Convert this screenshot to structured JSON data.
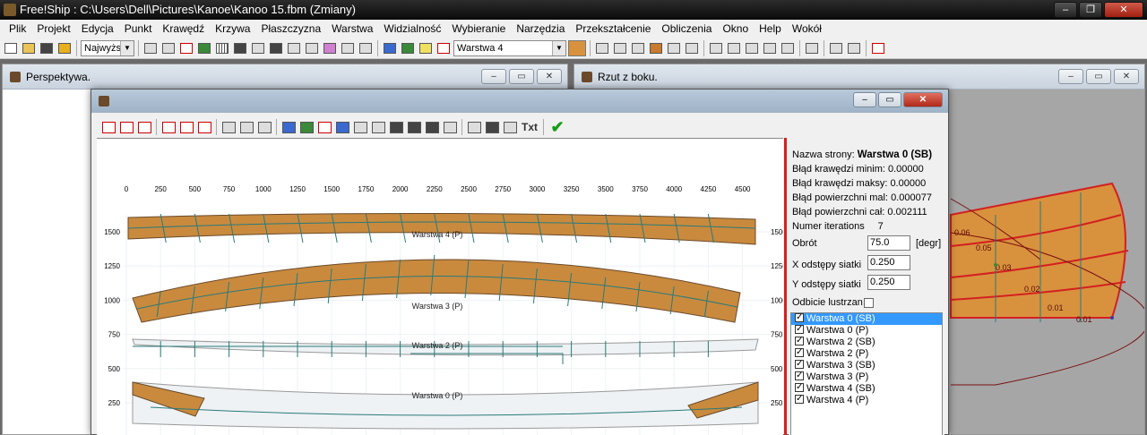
{
  "app": {
    "title": "Free!Ship  : C:\\Users\\Dell\\Pictures\\Kanoe\\Kanoo 15.fbm (Zmiany)"
  },
  "menu": [
    "Plik",
    "Projekt",
    "Edycja",
    "Punkt",
    "Krawędź",
    "Krzywa",
    "Płaszczyzna",
    "Warstwa",
    "Widzialność",
    "Wybieranie",
    "Narzędzia",
    "Przekształcenie",
    "Obliczenia",
    "Okno",
    "Help",
    "Wokół"
  ],
  "toolbar": {
    "precision_value": "Najwyższy",
    "layer_value": "Warstwa 4",
    "accent_color": "#d8923e"
  },
  "windows": {
    "perspective_title": "Perspektywa.",
    "side_title": "Rzut z boku."
  },
  "dialog": {
    "txt_label": "Txt",
    "props": {
      "page_name_label": "Nazwa strony:",
      "page_name_value": "Warstwa 0 (SB)",
      "edge_min_label": "Błąd krawędzi minim:",
      "edge_min_value": "0.00000",
      "edge_max_label": "Błąd krawędzi maksy:",
      "edge_max_value": "0.00000",
      "surf_min_label": "Błąd powierzchni mal:",
      "surf_min_value": "0.000077",
      "surf_total_label": "Błąd powierzchni cał:",
      "surf_total_value": "0.002111",
      "iterations_label": "Numer iterations",
      "iterations_value": "7",
      "rotation_label": "Obrót",
      "rotation_value": "75.0",
      "rotation_unit": "[degr]",
      "x_grid_label": "X odstępy siatki",
      "x_grid_value": "0.250",
      "y_grid_label": "Y odstępy siatki",
      "y_grid_value": "0.250",
      "mirror_label": "Odbicie lustrzan"
    },
    "layers": [
      "Warstwa 0 (SB)",
      "Warstwa 0 (P)",
      "Warstwa 2 (SB)",
      "Warstwa 2 (P)",
      "Warstwa 3 (SB)",
      "Warstwa 3 (P)",
      "Warstwa 4 (SB)",
      "Warstwa 4 (P)"
    ],
    "selected_layer": 0,
    "plot": {
      "x_ticks": [
        "0",
        "250",
        "500",
        "750",
        "1000",
        "1250",
        "1500",
        "1750",
        "2000",
        "2250",
        "2500",
        "2750",
        "3000",
        "3250",
        "3500",
        "3750",
        "4000",
        "4250",
        "4500"
      ],
      "y_ticks": [
        "1500",
        "1250",
        "1000",
        "750",
        "500",
        "250"
      ],
      "panel_labels": [
        "Warstwa 4 (P)",
        "Warstwa 3 (P)",
        "Warstwa 2 (P)",
        "Warstwa 0 (P)"
      ]
    }
  },
  "side_view": {
    "labels": [
      "0.06",
      "0.05",
      "0.03",
      "0.02",
      "0.01",
      "0.01"
    ]
  }
}
